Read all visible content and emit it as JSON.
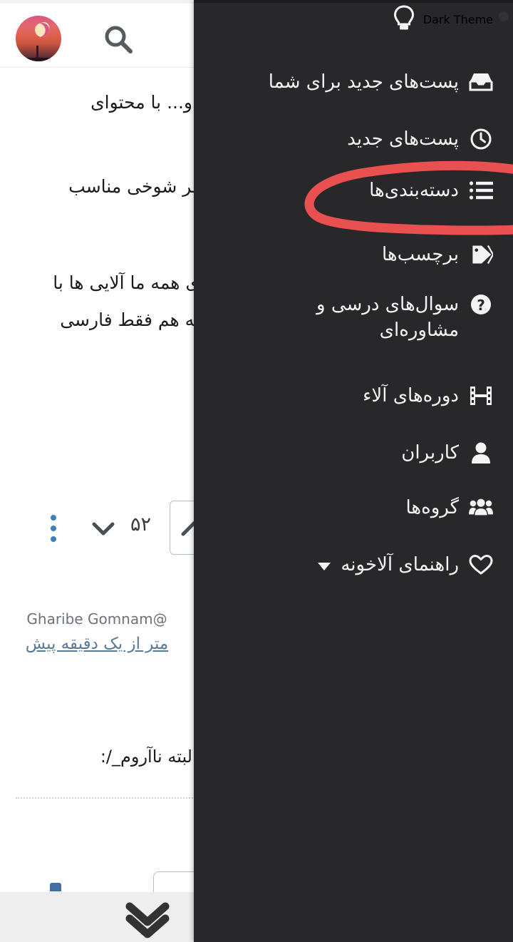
{
  "page": {
    "direction": "rtl",
    "background_color": "#ffffff"
  },
  "topbar": {
    "avatar_alt": "user-avatar-crescent-moon",
    "search_icon": "search-icon"
  },
  "post_content": {
    "lines": [
      "و... با محتوای",
      "فر شوخی مناسب",
      "ی همه ما آلایی ها با",
      "به هم فقط فارسی",
      "لبته ناآروم_/:"
    ]
  },
  "vote": {
    "count": "۵۲",
    "upvote_label": "upvote",
    "downvote_label": "downvote",
    "more_label": "more-options"
  },
  "author": {
    "name": "Gharibe Gomnam@",
    "time": "متر از یک دقیقه پیش"
  },
  "bottom_bar": {
    "scroll_icon": "double-chevron-down-icon"
  },
  "dark_menu": {
    "theme_label": "Dark Theme",
    "theme_icon": "lightbulb-icon",
    "background_color": "#28282b",
    "items": [
      {
        "label": "پست‌های جدید برای شما",
        "icon": "inbox-icon",
        "has_caret": false
      },
      {
        "label": "پست‌های جدید",
        "icon": "clock-icon",
        "has_caret": false
      },
      {
        "label": "دسته‌بندی‌ها",
        "icon": "list-icon",
        "has_caret": false,
        "annotated": true
      },
      {
        "label": "برچسب‌ها",
        "icon": "tag-icon",
        "has_caret": false
      },
      {
        "label": "سوال‌های درسی و\nمشاوره‌ای",
        "icon": "question-circle-icon",
        "has_caret": false
      },
      {
        "label": "دوره‌های آلاء",
        "icon": "film-icon",
        "has_caret": false
      },
      {
        "label": "کاربران",
        "icon": "user-icon",
        "has_caret": false
      },
      {
        "label": "گروه‌ها",
        "icon": "users-group-icon",
        "has_caret": false
      },
      {
        "label": "راهنمای آلاخونه",
        "icon": "heart-icon",
        "has_caret": true
      }
    ]
  },
  "annotation": {
    "type": "hand-drawn-ellipse",
    "color": "#e8514f",
    "target": "دسته‌بندی‌ها"
  }
}
